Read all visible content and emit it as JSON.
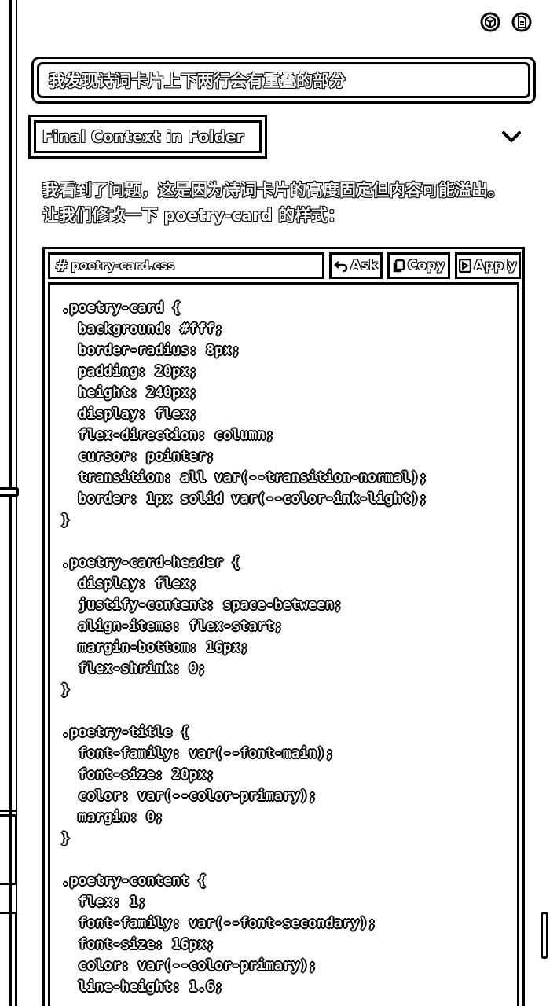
{
  "toolbar": {
    "icons": [
      "cube-icon",
      "file-icon"
    ]
  },
  "query": {
    "text": "我发现诗词卡片上下两行会有重叠的部分"
  },
  "context": {
    "label": "Final Context in Folder"
  },
  "message": {
    "text": "我看到了问题，这是因为诗词卡片的高度固定但内容可能溢出。让我们修改一下 poetry-card 的样式："
  },
  "codeblock": {
    "hash": "#",
    "filename": "poetry-card.css",
    "ask_label": "Ask",
    "copy_label": "Copy",
    "apply_label": "Apply",
    "code": ".poetry-card {\n  background: #fff;\n  border-radius: 8px;\n  padding: 20px;\n  height: 240px;\n  display: flex;\n  flex-direction: column;\n  cursor: pointer;\n  transition: all var(--transition-normal);\n  border: 1px solid var(--color-ink-light);\n}\n\n.poetry-card-header {\n  display: flex;\n  justify-content: space-between;\n  align-items: flex-start;\n  margin-bottom: 16px;\n  flex-shrink: 0;\n}\n\n.poetry-title {\n  font-family: var(--font-main);\n  font-size: 20px;\n  color: var(--color-primary);\n  margin: 0;\n}\n\n.poetry-content {\n  flex: 1;\n  font-family: var(--font-secondary);\n  font-size: 16px;\n  color: var(--color-primary);\n  line-height: 1.6;"
  }
}
